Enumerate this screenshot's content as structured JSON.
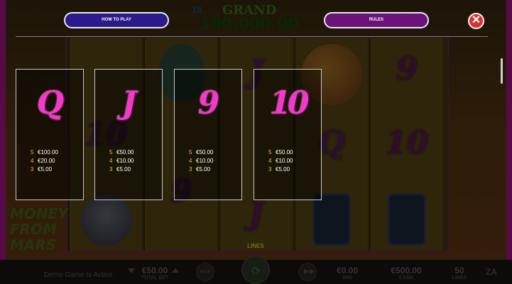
{
  "game": {
    "jackpot": {
      "count": "15",
      "label": "GRAND",
      "value": "100,000.00"
    },
    "logo_text": "MONEY FROM MARS",
    "lines_label": "LINES",
    "reels": [
      {
        "symbols": [
          "",
          "10",
          "9"
        ]
      },
      {
        "symbols": [
          "",
          "9",
          ""
        ]
      },
      {
        "symbols": [
          "J",
          "",
          "J"
        ]
      },
      {
        "symbols": [
          "",
          "Q",
          ""
        ]
      },
      {
        "symbols": [
          "9",
          "10",
          ""
        ]
      }
    ]
  },
  "nav": {
    "how_to_play": "HOW TO PLAY",
    "rules": "RULES",
    "close": "✕"
  },
  "paytable": [
    {
      "symbol": "Q",
      "pays": [
        {
          "count": "5",
          "amount": "€100.00"
        },
        {
          "count": "4",
          "amount": "€20.00"
        },
        {
          "count": "3",
          "amount": "€5.00"
        }
      ]
    },
    {
      "symbol": "J",
      "pays": [
        {
          "count": "5",
          "amount": "€50.00"
        },
        {
          "count": "4",
          "amount": "€10.00"
        },
        {
          "count": "3",
          "amount": "€5.00"
        }
      ]
    },
    {
      "symbol": "9",
      "pays": [
        {
          "count": "5",
          "amount": "€50.00"
        },
        {
          "count": "4",
          "amount": "€10.00"
        },
        {
          "count": "3",
          "amount": "€5.00"
        }
      ]
    },
    {
      "symbol": "10",
      "pays": [
        {
          "count": "5",
          "amount": "€50.00"
        },
        {
          "count": "4",
          "amount": "€10.00"
        },
        {
          "count": "3",
          "amount": "€5.00"
        }
      ]
    }
  ],
  "bottom_bar": {
    "demo_text": "Demo Game Is Active",
    "total_bet": {
      "value": "€50.00",
      "label": "TOTAL BET"
    },
    "max_label": "MAX",
    "win": {
      "value": "€0.00",
      "label": "WIN"
    },
    "cash": {
      "value": "€500.00",
      "label": "CASH"
    },
    "lines": {
      "value": "50",
      "label": "LINES"
    },
    "brand_icon": "ZA"
  },
  "colors": {
    "accent_pink": "#f239c8",
    "pill_blue": "#2a1a8a",
    "pill_purple": "#6a137a",
    "close_red": "#d8322e",
    "pay_count_yellow": "#f2c21a"
  },
  "icons": {
    "close": "close-icon",
    "spin": "spin-icon",
    "fast_forward": "fast-forward-icon",
    "bet_down": "triangle-down-icon",
    "bet_up": "triangle-up-icon"
  }
}
